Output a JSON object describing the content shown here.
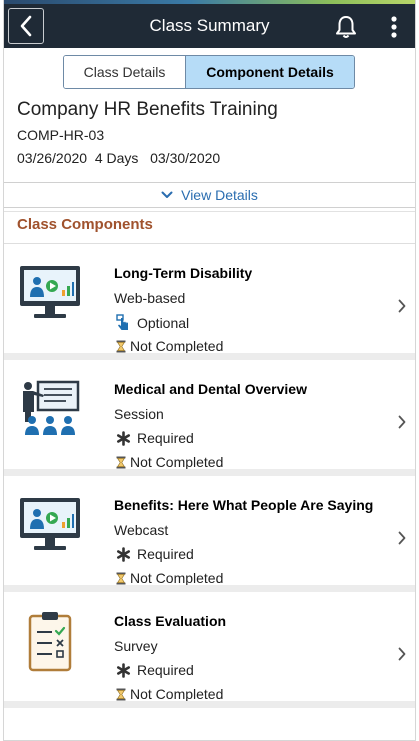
{
  "header": {
    "title": "Class Summary",
    "back_icon": "chevron-left-icon",
    "notifications_icon": "bell-icon",
    "menu_icon": "more-vertical-icon"
  },
  "tabs": [
    {
      "label": "Class Details",
      "selected": false
    },
    {
      "label": "Component Details",
      "selected": true
    }
  ],
  "class": {
    "title": "Company HR Benefits Training",
    "code": "COMP-HR-03",
    "start_date": "03/26/2020",
    "duration": "4 Days",
    "end_date": "03/30/2020"
  },
  "view_details": {
    "label": "View Details",
    "icon": "chevron-down-icon"
  },
  "section": {
    "title": "Class Components"
  },
  "components": [
    {
      "name": "Long-Term Disability",
      "type": "Web-based",
      "requirement": "Optional",
      "requirement_icon": "hand-pointer-icon",
      "status": "Not Completed",
      "status_icon": "hourglass-icon",
      "icon": "monitor-video-icon"
    },
    {
      "name": "Medical and Dental Overview",
      "type": "Session",
      "requirement": "Required",
      "requirement_icon": "asterisk-icon",
      "status": "Not Completed",
      "status_icon": "hourglass-icon",
      "icon": "classroom-icon"
    },
    {
      "name": "Benefits: Here What People Are Saying",
      "type": "Webcast",
      "requirement": "Required",
      "requirement_icon": "asterisk-icon",
      "status": "Not Completed",
      "status_icon": "hourglass-icon",
      "icon": "monitor-video-icon"
    },
    {
      "name": "Class Evaluation",
      "type": "Survey",
      "requirement": "Required",
      "requirement_icon": "asterisk-icon",
      "status": "Not Completed",
      "status_icon": "hourglass-icon",
      "icon": "clipboard-survey-icon"
    }
  ],
  "colors": {
    "header_bg": "#1f2a36",
    "selected_tab_bg": "#b6dcf7",
    "link": "#2a6db0",
    "section_title": "#a0522d"
  }
}
